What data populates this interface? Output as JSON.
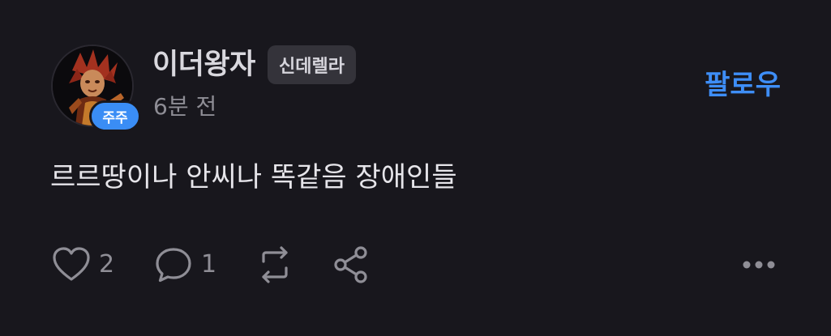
{
  "post": {
    "author": {
      "name": "이더왕자",
      "tag": "신데렐라",
      "badge": "주주",
      "avatar": "character-illustration-avatar"
    },
    "time": "6분 전",
    "follow_label": "팔로우",
    "body": "르르땅이나 안씨나 똑같음 장애인들",
    "actions": {
      "like": {
        "icon": "heart-icon",
        "count": "2"
      },
      "comment": {
        "icon": "comment-bubble-icon",
        "count": "1"
      },
      "repost": {
        "icon": "repost-icon"
      },
      "share": {
        "icon": "share-icon"
      },
      "more": {
        "icon": "more-dots-icon"
      }
    }
  },
  "colors": {
    "background": "#18171d",
    "accent": "#3e8ef7",
    "badge": "#3a8df5",
    "muted_text": "#8e8d95",
    "tag_bg": "#34333a"
  }
}
